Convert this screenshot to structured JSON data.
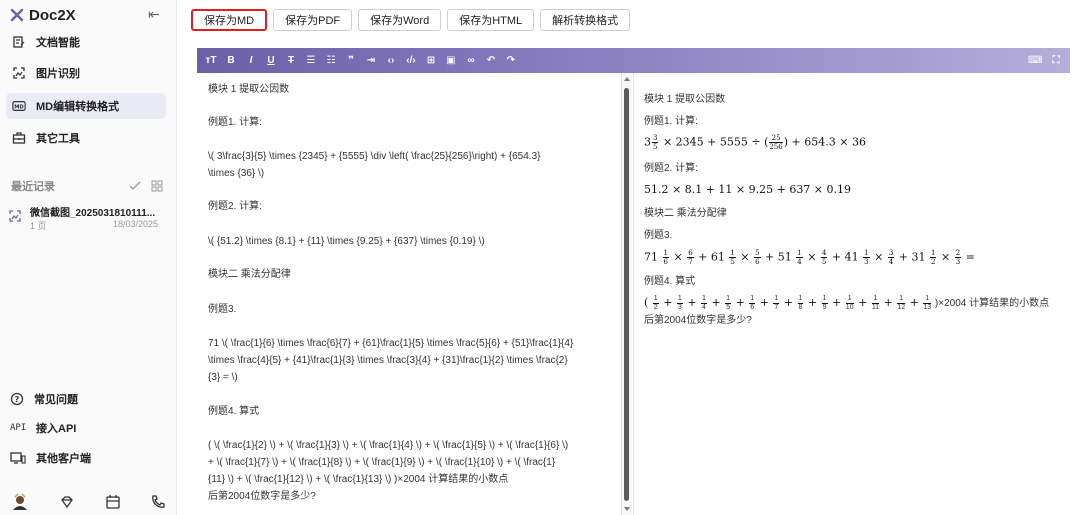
{
  "brand": {
    "name": "Doc2X",
    "accent": "#6b5fa8"
  },
  "nav": [
    {
      "label": "文档智能",
      "icon": "doc-edit-icon"
    },
    {
      "label": "图片识别",
      "icon": "image-scan-icon"
    },
    {
      "label": "MD编辑转换格式",
      "icon": "markdown-icon",
      "active": true
    },
    {
      "label": "其它工具",
      "icon": "toolbox-icon"
    }
  ],
  "recent": {
    "title": "最近记录",
    "item": {
      "name": "微信截图_2025031810111...",
      "pages": "1 页",
      "date": "18/03/2025"
    }
  },
  "bottom": [
    {
      "label": "常见问题"
    },
    {
      "label": "接入API",
      "tag": "API"
    },
    {
      "label": "其他客户端"
    }
  ],
  "actions": [
    {
      "label": "保存为MD",
      "highlight": true
    },
    {
      "label": "保存为PDF"
    },
    {
      "label": "保存为Word"
    },
    {
      "label": "保存为HTML"
    },
    {
      "label": "解析转换格式"
    }
  ],
  "toolbar_icons": [
    "text-size-icon",
    "bold-icon",
    "italic-icon",
    "underline-icon",
    "strikethrough-icon",
    "bullet-list-icon",
    "ordered-list-icon",
    "quote-icon",
    "indent-icon",
    "code-icon",
    "code-block-icon",
    "table-icon",
    "image-icon",
    "link-icon",
    "undo-icon",
    "redo-icon"
  ],
  "markdown": [
    "模块 1 提取公因数",
    "例题1. 计算:",
    "\\( 3\\frac{3}{5} \\times  {2345} + {5555} \\div  \\left( \\frac{25}{256}\\right)  + {654.3}",
    "\\times  {36} \\)",
    "例题2. 计算:",
    "\\( {51.2} \\times  {8.1} + {11} \\times  {9.25} + {637} \\times  {0.19} \\)",
    "模块二 乘法分配律",
    "例题3.",
    "71 \\( \\frac{1}{6} \\times  \\frac{6}{7} + {61}\\frac{1}{5} \\times  \\frac{5}{6} + {51}\\frac{1}{4}",
    "\\times  \\frac{4}{5} + {41}\\frac{1}{3} \\times  \\frac{3}{4} + {31}\\frac{1}{2} \\times  \\frac{2}",
    "{3} = \\)",
    "例题4. 算式",
    "( \\( \\frac{1}{2} \\) + \\( \\frac{1}{3} \\) + \\( \\frac{1}{4} \\) + \\( \\frac{1}{5} \\) + \\( \\frac{1}{6} \\)",
    "+ \\( \\frac{1}{7} \\) + \\( \\frac{1}{8} \\) + \\( \\frac{1}{9} \\) + \\( \\frac{1}{10} \\) + \\( \\frac{1}",
    "{11} \\) + \\( \\frac{1}{12} \\) + \\( \\frac{1}{13} \\) )×2004 计算结果的小数点",
    "后第2004位数字是多少?"
  ],
  "preview": {
    "m1": "模块 1 提取公因数",
    "e1": "例题1. 计算:",
    "eq1": {
      "a": "3",
      "b": " × 2345 + 5555 ÷ (",
      "c": ") + 654.3 × 36",
      "f1": [
        "3",
        "5"
      ],
      "f2": [
        "25",
        "256"
      ]
    },
    "e2": "例题2. 计算:",
    "eq2": "51.2 × 8.1 + 11 × 9.25 + 637 × 0.19",
    "m2": "模块二 乘法分配律",
    "e3": "例题3.",
    "eq3": {
      "terms": [
        {
          "w": "71",
          "a": [
            "1",
            "6"
          ],
          "b": [
            "6",
            "7"
          ]
        },
        {
          "w": "61",
          "a": [
            "1",
            "5"
          ],
          "b": [
            "5",
            "6"
          ]
        },
        {
          "w": "51",
          "a": [
            "1",
            "4"
          ],
          "b": [
            "4",
            "5"
          ]
        },
        {
          "w": "41",
          "a": [
            "1",
            "3"
          ],
          "b": [
            "3",
            "4"
          ]
        },
        {
          "w": "31",
          "a": [
            "1",
            "2"
          ],
          "b": [
            "2",
            "3"
          ]
        }
      ],
      "end": "="
    },
    "e4": "例题4. 算式",
    "eq4": {
      "dens": [
        "2",
        "3",
        "4",
        "5",
        "6",
        "7",
        "8",
        "9",
        "10",
        "11",
        "12",
        "13"
      ],
      "tail": ")×2004 计算结果的小数点",
      "line2": "后第2004位数字是多少?"
    }
  }
}
